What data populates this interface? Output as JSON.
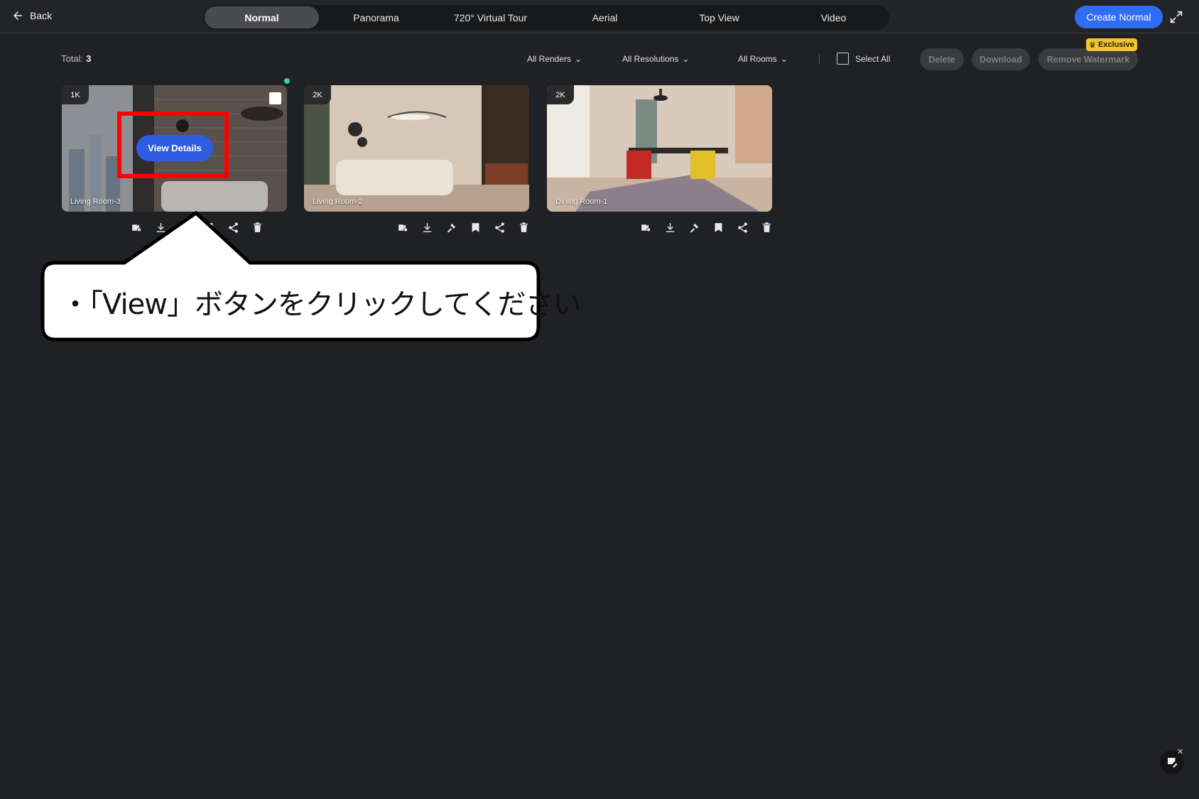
{
  "topbar": {
    "back_label": "Back",
    "tabs": [
      {
        "label": "Normal",
        "active": true
      },
      {
        "label": "Panorama"
      },
      {
        "label": "720° Virtual Tour"
      },
      {
        "label": "Aerial"
      },
      {
        "label": "Top View"
      },
      {
        "label": "Video"
      }
    ],
    "create_label": "Create Normal"
  },
  "toolbar": {
    "total_label": "Total:",
    "total_count": "3",
    "filters": {
      "renders": "All Renders",
      "resolutions": "All Resolutions",
      "rooms": "All Rooms"
    },
    "select_all": "Select All",
    "delete_label": "Delete",
    "download_label": "Download",
    "remove_watermark_label": "Remove Watermark",
    "exclusive_badge": "Exclusive"
  },
  "cards": [
    {
      "resolution": "1K",
      "room": "Living Room-3",
      "view_details": "View Details"
    },
    {
      "resolution": "2K",
      "room": "Living Room-2"
    },
    {
      "resolution": "2K",
      "room": "Dining Room-1"
    }
  ],
  "callout": {
    "text": "・「View」ボタンをクリックしてください"
  },
  "colors": {
    "accent": "#2f6df6",
    "highlight": "#ff0000",
    "exclusive": "#f2c230"
  }
}
